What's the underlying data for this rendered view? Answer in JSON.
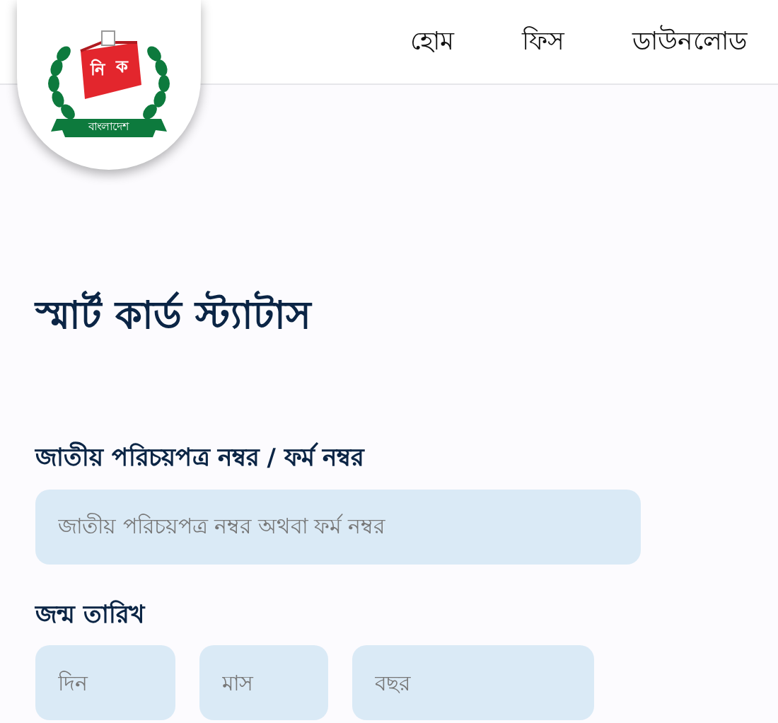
{
  "logo": {
    "box_letters": [
      "নি",
      "ক"
    ],
    "ribbon": "বাংলাদেশ"
  },
  "nav": [
    {
      "label": "হোম"
    },
    {
      "label": "ফিস"
    },
    {
      "label": "ডাউনলোড"
    }
  ],
  "title": "স্মার্ট কার্ড স্ট্যাটাস",
  "id_field": {
    "label": "জাতীয় পরিচয়পত্র নম্বর / ফর্ম নম্বর",
    "placeholder": "জাতীয় পরিচয়পত্র নম্বর অথবা ফর্ম নম্বর"
  },
  "birth_date": {
    "label": "জন্ম তারিখ",
    "fields": [
      {
        "placeholder": "দিন"
      },
      {
        "placeholder": "মাস"
      },
      {
        "placeholder": "বছর"
      }
    ]
  }
}
